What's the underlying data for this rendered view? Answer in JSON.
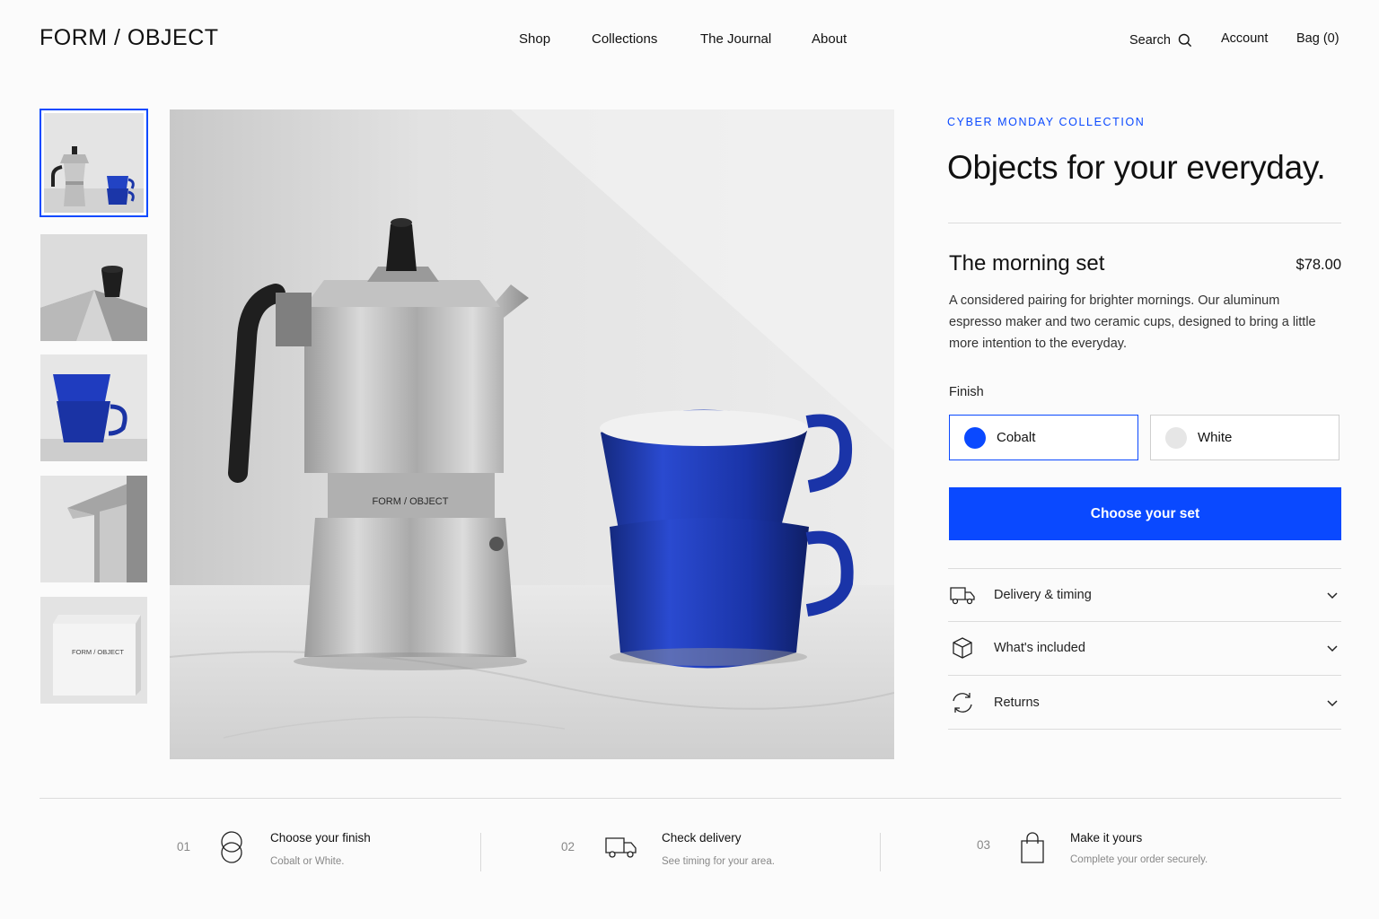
{
  "brand": "FORM / OBJECT",
  "nav": {
    "items": [
      "Shop",
      "Collections",
      "The Journal",
      "About"
    ]
  },
  "utility": {
    "search": "Search",
    "account": "Account",
    "bag": "Bag (0)"
  },
  "hero": {
    "print": "FORM / OBJECT"
  },
  "thumbnails": {
    "box_print": "FORM / OBJECT"
  },
  "product": {
    "eyebrow": "CYBER MONDAY COLLECTION",
    "headline": "Objects for your everyday.",
    "name": "The morning set",
    "price": "$78.00",
    "description": "A considered pairing for brighter mornings. Our aluminum espresso maker and two ceramic cups, designed to bring a little more intention to the everyday.",
    "finish_label": "Finish",
    "finishes": [
      {
        "label": "Cobalt",
        "color": "#0a49ff",
        "selected": true
      },
      {
        "label": "White",
        "color": "#e6e6e6",
        "selected": false
      }
    ],
    "cta": "Choose your set"
  },
  "accordion": [
    {
      "label": "Delivery & timing",
      "icon": "truck-icon"
    },
    {
      "label": "What's included",
      "icon": "box-icon"
    },
    {
      "label": "Returns",
      "icon": "refresh-icon"
    }
  ],
  "steps": [
    {
      "num": "01",
      "title": "Choose your finish",
      "sub": "Cobalt or White.",
      "icon": "rings-icon"
    },
    {
      "num": "02",
      "title": "Check delivery",
      "sub": "See timing for your area.",
      "icon": "truck-icon"
    },
    {
      "num": "03",
      "title": "Make it yours",
      "sub": "Complete your order securely.",
      "icon": "bag-icon"
    }
  ],
  "colors": {
    "accent": "#0a49ff",
    "text": "#111111",
    "muted": "#888888"
  }
}
